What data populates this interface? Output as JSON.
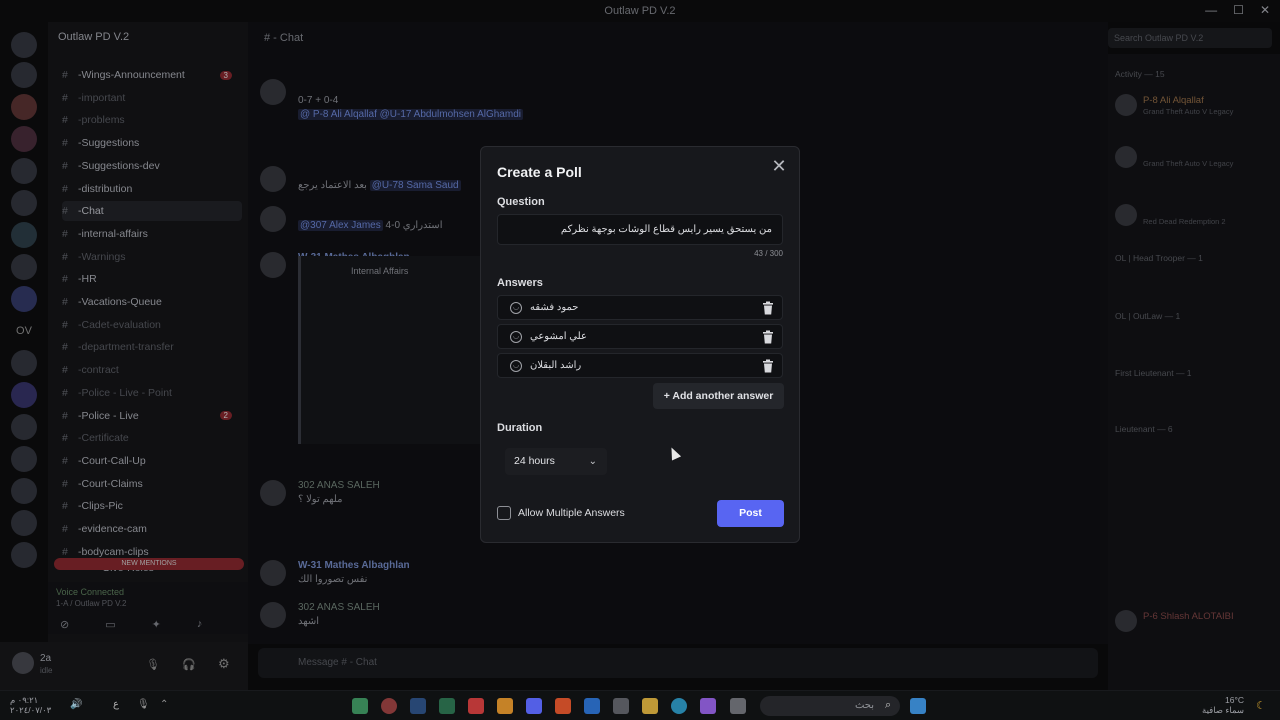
{
  "window": {
    "title": "Outlaw PD V.2"
  },
  "server": {
    "name": "Outlaw PD V.2"
  },
  "channels": [
    {
      "name": "Wings-Announcement",
      "badge": "3",
      "style": "bright"
    },
    {
      "name": "important",
      "badge": "",
      "style": "dim"
    },
    {
      "name": "problems",
      "badge": "",
      "style": "dim"
    },
    {
      "name": "Suggestions",
      "badge": "",
      "style": "bright"
    },
    {
      "name": "Suggestions-dev",
      "badge": "",
      "style": "bright"
    },
    {
      "name": "distribution",
      "badge": "",
      "style": "bright"
    },
    {
      "name": "Chat",
      "badge": "",
      "style": "active"
    },
    {
      "name": "internal-affairs",
      "badge": "",
      "style": "bright"
    },
    {
      "name": "Warnings",
      "badge": "",
      "style": "dim"
    },
    {
      "name": "HR",
      "badge": "",
      "style": "bright"
    },
    {
      "name": "Vacations-Queue",
      "badge": "",
      "style": "bright"
    },
    {
      "name": "Cadet-evaluation",
      "badge": "",
      "style": "dim"
    },
    {
      "name": "department-transfer",
      "badge": "",
      "style": "dim"
    },
    {
      "name": "contract",
      "badge": "",
      "style": "dim"
    },
    {
      "name": "Police - Live - Point",
      "badge": "",
      "style": "dim"
    },
    {
      "name": "Police - Live",
      "badge": "2",
      "style": "bright"
    },
    {
      "name": "Certificate",
      "badge": "",
      "style": "dim"
    },
    {
      "name": "Court-Call-Up",
      "badge": "",
      "style": "bright"
    },
    {
      "name": "Court-Claims",
      "badge": "",
      "style": "bright"
    },
    {
      "name": "Clips-Pic",
      "badge": "",
      "style": "bright"
    },
    {
      "name": "evidence-cam",
      "badge": "",
      "style": "bright"
    },
    {
      "name": "bodycam-clips",
      "badge": "",
      "style": "bright"
    }
  ],
  "new_mentions": "NEW MENTIONS",
  "give_roles": "Give-Roles",
  "voice": {
    "title": "Voice Connected",
    "sub": "1-A / Outlaw PD V.2"
  },
  "user": {
    "name": "2a",
    "status": "idle"
  },
  "header": {
    "channel": "Chat",
    "search_placeholder": "Search Outlaw PD V.2"
  },
  "messages": [
    {
      "name": "",
      "time": "",
      "text": "0-7 + 0-4",
      "mentions": "@ P-8 Ali Alqallaf  @U-17 Abdulmohsen AlGhamdi"
    },
    {
      "name": "",
      "text": "بعد الاعتماد يرجع",
      "mention": "@U-78 Sama Saud"
    },
    {
      "name": "",
      "text": "استدراري 0-4",
      "mention": "@307 Alex James"
    },
    {
      "name": "W-31 Mathes Albaghlan",
      "text": "Internal Affairs"
    },
    {
      "name": "302 ANAS SALEH",
      "text": "ملهم تولا ؟"
    },
    {
      "name": "W-31 Mathes Albaghlan",
      "text": "نفس تصوروا الك"
    },
    {
      "name": "302 ANAS SALEH",
      "text": "اشهد"
    }
  ],
  "composer": {
    "placeholder": "Message # - Chat"
  },
  "members": {
    "activity_header": "Activity — 15",
    "items": [
      {
        "name": "P-8 Ali Alqallaf",
        "sub": "Grand Theft Auto V Legacy"
      },
      {
        "name": "",
        "sub": "Grand Theft Auto V Legacy"
      },
      {
        "name": "",
        "sub": "Red Dead Redemption 2"
      }
    ],
    "groups": [
      "OL | Head Trooper — 1",
      "OL | OutLaw — 1",
      "First Lieutenant — 1",
      "Lieutenant — 6"
    ],
    "lower": [
      {
        "name": "P-6 Shlash ALOTAIBI"
      }
    ]
  },
  "poll": {
    "title": "Create a Poll",
    "question_label": "Question",
    "question_value": "من يستحق يسير رايس قطاع الوشات بوجهة نظركم",
    "counter": "43 / 300",
    "answers_label": "Answers",
    "answers": [
      {
        "text": "حمود فشقه"
      },
      {
        "text": "علي امشوعي"
      },
      {
        "text": "راشد البقلان"
      }
    ],
    "add_answer": "Add another answer",
    "duration_label": "Duration",
    "duration_value": "24 hours",
    "allow_multiple": "Allow Multiple Answers",
    "post": "Post"
  },
  "taskbar": {
    "search_placeholder": "بحث",
    "time": "٠٩:٢١ م",
    "date": "٢٠٢٤/٠٧/٠٣",
    "weather_temp": "16°C",
    "weather_text": "سماء صافية",
    "lang": "ع"
  },
  "colors": {
    "accent": "#5865f2",
    "modal_bg": "#17181c"
  }
}
